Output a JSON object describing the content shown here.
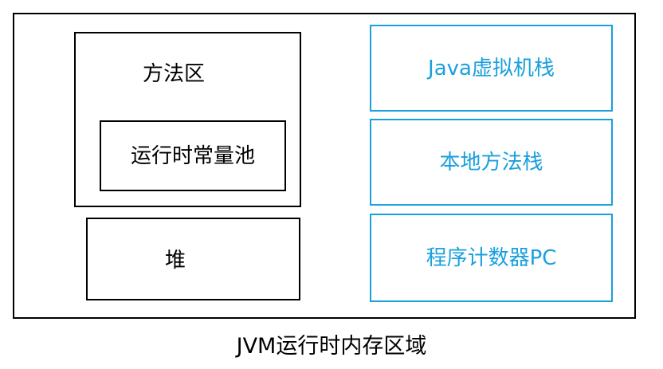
{
  "title": "JVM运行时内存区域",
  "method_area": {
    "label": "方法区",
    "runtime_constant_pool": "运行时常量池"
  },
  "heap": "堆",
  "thread_private": {
    "java_vm_stack": "Java虚拟机栈",
    "native_method_stack": "本地方法栈",
    "program_counter": "程序计数器PC"
  },
  "colors": {
    "shared_border": "#000000",
    "private_border": "#1aa0dd"
  }
}
